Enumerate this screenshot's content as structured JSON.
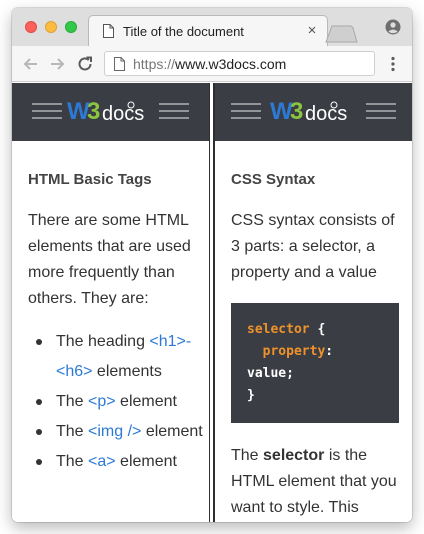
{
  "browser": {
    "tab_title": "Title of the document",
    "close_label": "×",
    "url_scheme": "https://",
    "url_host": "www.w3docs.com"
  },
  "left": {
    "logo_text": "docs",
    "heading": "HTML Basic Tags",
    "paragraph": "There are some HTML elements that are used more frequently than others. They are:",
    "list": [
      {
        "pre": "The heading ",
        "code": "<h1>-<h6>",
        "post": " elements"
      },
      {
        "pre": "The ",
        "code": "<p>",
        "post": " element"
      },
      {
        "pre": "The ",
        "code": "<img />",
        "post": " element"
      },
      {
        "pre": "The ",
        "code": "<a>",
        "post": " element"
      }
    ]
  },
  "right": {
    "logo_text": "docs",
    "heading": "CSS Syntax",
    "paragraph": "CSS syntax consists of 3 parts: a selector, a property and a value",
    "code": {
      "line1_a": "selector",
      "line1_b": " {",
      "line2_a": "property",
      "line2_b": ":",
      "line3": "value;",
      "line4": "}"
    },
    "p2_pre": "The ",
    "p2_bold": "selector",
    "p2_post": " is the HTML element that you want to style. This"
  },
  "colors": {
    "header_bg": "#3a3e44",
    "link": "#2c7ad6",
    "code_keyword": "#f0922b",
    "logo_w": "#2c7ad6",
    "logo_3": "#8bc53f"
  }
}
